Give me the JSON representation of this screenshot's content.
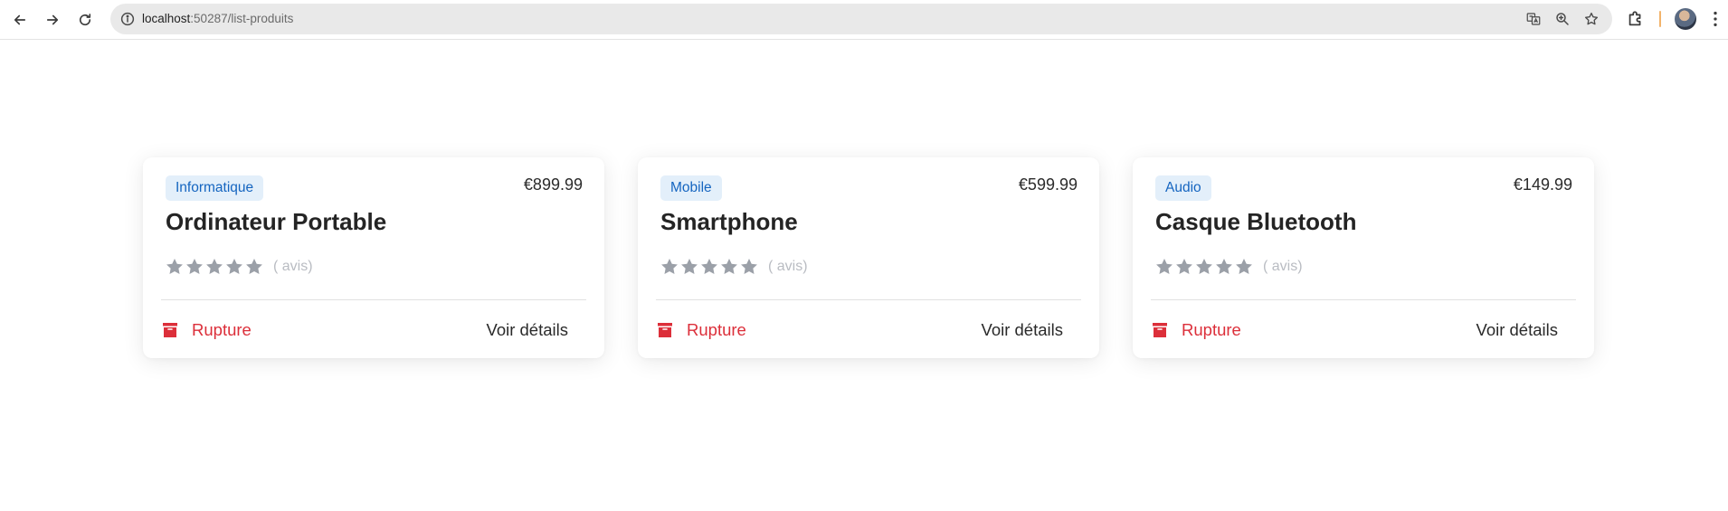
{
  "browser": {
    "url_host": "localhost",
    "url_path": ":50287/list-produits"
  },
  "products": [
    {
      "category": "Informatique",
      "price": "€899.99",
      "name": "Ordinateur Portable",
      "rating": 0,
      "reviews": "( avis)",
      "stock_label": "Rupture",
      "details_label": "Voir détails"
    },
    {
      "category": "Mobile",
      "price": "€599.99",
      "name": "Smartphone",
      "rating": 0,
      "reviews": "( avis)",
      "stock_label": "Rupture",
      "details_label": "Voir détails"
    },
    {
      "category": "Audio",
      "price": "€149.99",
      "name": "Casque Bluetooth",
      "rating": 0,
      "reviews": "( avis)",
      "stock_label": "Rupture",
      "details_label": "Voir détails"
    }
  ],
  "colors": {
    "badge_text": "#1565c0",
    "badge_bg": "#e3effa",
    "out_of_stock": "#dc2f3a",
    "star_empty": "#9ba0a8"
  },
  "icons": {
    "back": "arrow-left-icon",
    "forward": "arrow-right-icon",
    "reload": "reload-icon",
    "site_info": "info-icon",
    "translate": "translate-icon",
    "zoom": "zoom-icon",
    "bookmark": "star-outline-icon",
    "extensions": "puzzle-icon",
    "menu": "kebab-menu-icon",
    "stock": "box-icon"
  }
}
